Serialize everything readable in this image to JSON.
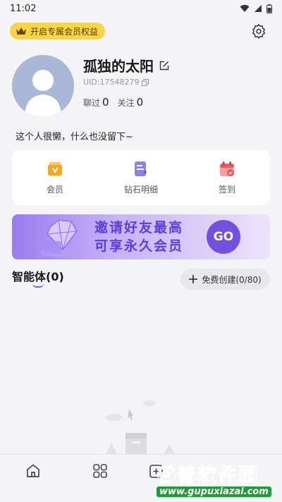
{
  "status_bar": {
    "time": "11:02"
  },
  "vip_banner": {
    "label": "开启专属会员权益"
  },
  "profile": {
    "name": "孤独的太阳",
    "uid": "UID:17548279",
    "chats_label": "聊过",
    "chats_count": "0",
    "following_label": "关注",
    "following_count": "0",
    "bio": "这个人很懒，什么也没留下~"
  },
  "actions": [
    {
      "label": "会员",
      "icon": "vip-card-icon",
      "color": "#f5a623"
    },
    {
      "label": "钻石明细",
      "icon": "diamond-detail-icon",
      "color": "#7b74d8"
    },
    {
      "label": "签到",
      "icon": "calendar-checkin-icon",
      "color": "#ea5a5a"
    }
  ],
  "invite_banner": {
    "line1": "邀请好友最高",
    "line2": "可享永久会员",
    "button": "GO"
  },
  "agents": {
    "title": "智能体(0)",
    "create_label": "免费创建(0/80)"
  },
  "tabbar": {
    "items": [
      {
        "icon": "home-icon"
      },
      {
        "icon": "apps-grid-icon"
      },
      {
        "icon": "ai-create-icon"
      }
    ]
  },
  "watermark": {
    "title": "谷普软件园",
    "url": "www.gupuxiazai.com"
  },
  "colors": {
    "accent": "#7b5df2",
    "vip": "#f7d548",
    "watermark": "#1f9b3a"
  }
}
